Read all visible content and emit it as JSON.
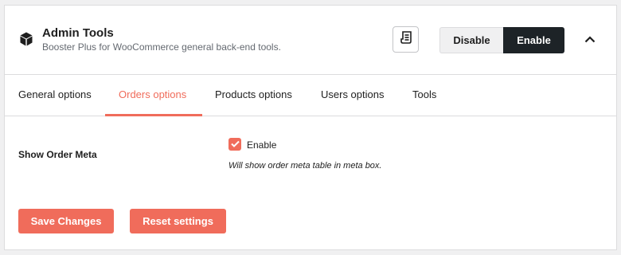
{
  "module": {
    "title": "Admin Tools",
    "subtitle": "Booster Plus for WooCommerce general back-end tools.",
    "icon": "cube-icon",
    "docs_icon": "document-icon",
    "disable_label": "Disable",
    "enable_label": "Enable",
    "collapse_icon": "chevron-up-icon"
  },
  "tabs": [
    {
      "label": "General options",
      "active": false
    },
    {
      "label": "Orders options",
      "active": true
    },
    {
      "label": "Products options",
      "active": false
    },
    {
      "label": "Users options",
      "active": false
    },
    {
      "label": "Tools",
      "active": false
    }
  ],
  "settings": {
    "show_order_meta": {
      "label": "Show Order Meta",
      "checkbox_label": "Enable",
      "checked": true,
      "description": "Will show order meta table in meta box."
    }
  },
  "actions": {
    "save_label": "Save Changes",
    "reset_label": "Reset settings"
  },
  "colors": {
    "accent": "#f06c5b",
    "dark": "#1d2327",
    "border": "#dcdcde"
  }
}
